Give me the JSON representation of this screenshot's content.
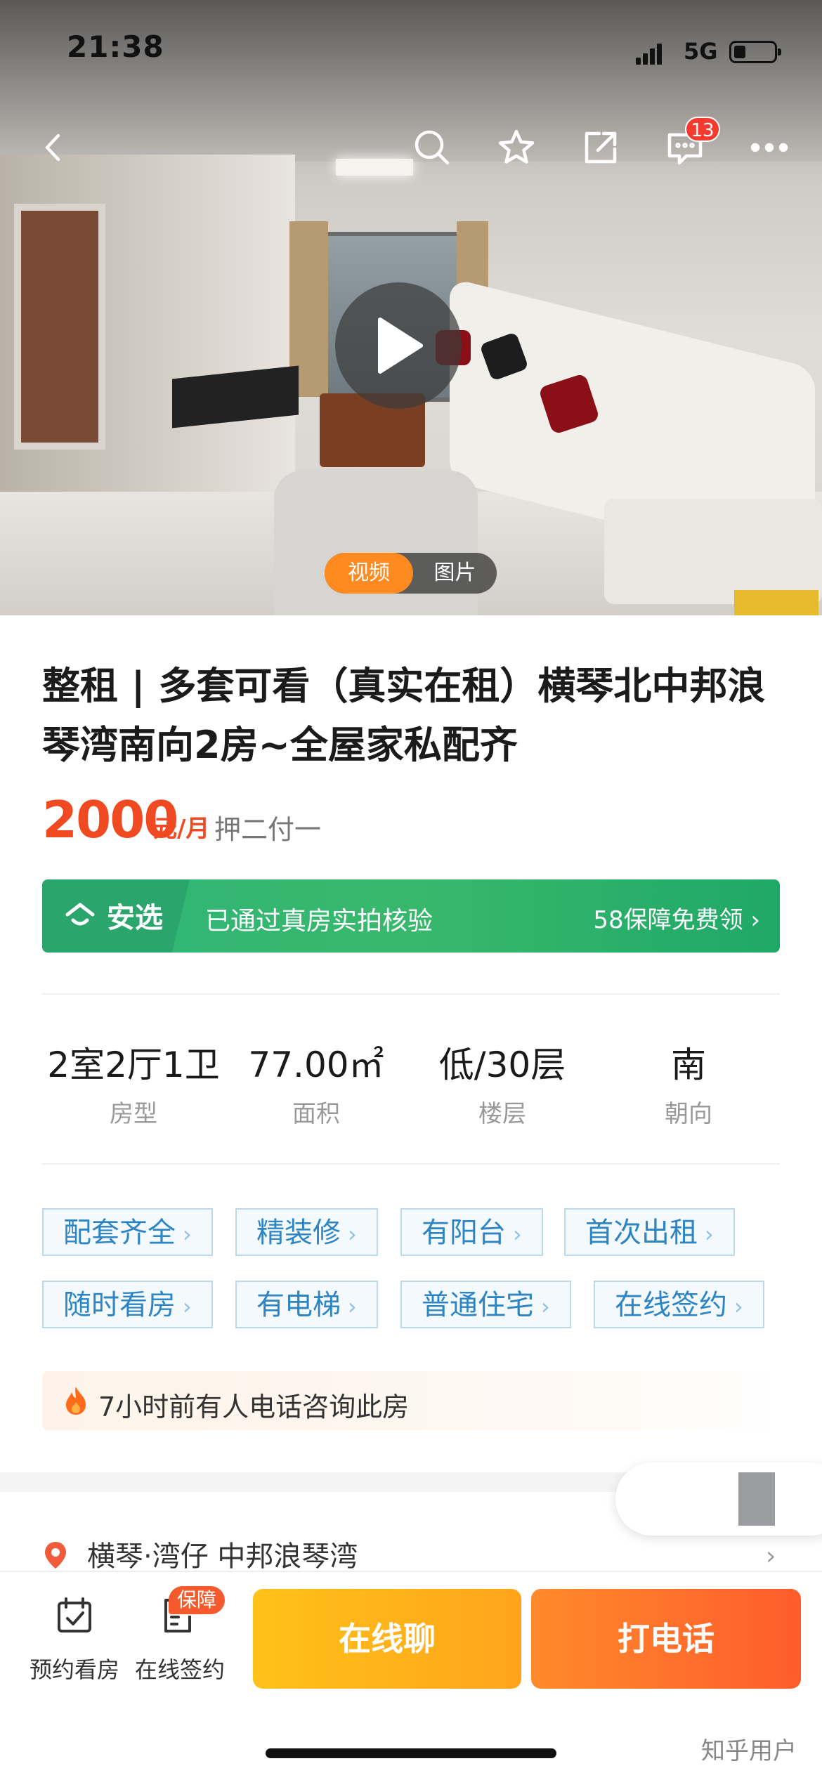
{
  "status_bar": {
    "time": "21:38",
    "network": "5G"
  },
  "nav": {
    "message_count": "13"
  },
  "media": {
    "tabs": [
      "视频",
      "图片"
    ]
  },
  "listing": {
    "title": "整租 | 多套可看（真实在租）横琴北中邦浪琴湾南向2房~全屋家私配齐",
    "price": "2000",
    "price_unit": "元/月",
    "deposit": "押二付一"
  },
  "banner": {
    "brand": "安选",
    "text": "已通过真房实拍核验",
    "action": "58保障免费领"
  },
  "specs": [
    {
      "value": "2室2厅1卫",
      "label": "房型"
    },
    {
      "value": "77.00㎡",
      "label": "面积"
    },
    {
      "value": "低/30层",
      "label": "楼层"
    },
    {
      "value": "南",
      "label": "朝向"
    }
  ],
  "tags_row1": [
    "配套齐全",
    "精装修",
    "有阳台",
    "首次出租"
  ],
  "tags_row2": [
    "随时看房",
    "有电梯",
    "普通住宅",
    "在线签约"
  ],
  "hint": "7小时前有人电话咨询此房",
  "location": "横琴·湾仔 中邦浪琴湾",
  "bottom": {
    "schedule_label": "预约看房",
    "sign_label": "在线签约",
    "sign_badge": "保障",
    "chat_label": "在线聊",
    "call_label": "打电话"
  },
  "watermark": "知乎用户",
  "colors": {
    "price": "#f04a23",
    "accent_orange": "#ff8a1f",
    "green": "#2fb578",
    "tag_blue": "#2e85c4"
  }
}
